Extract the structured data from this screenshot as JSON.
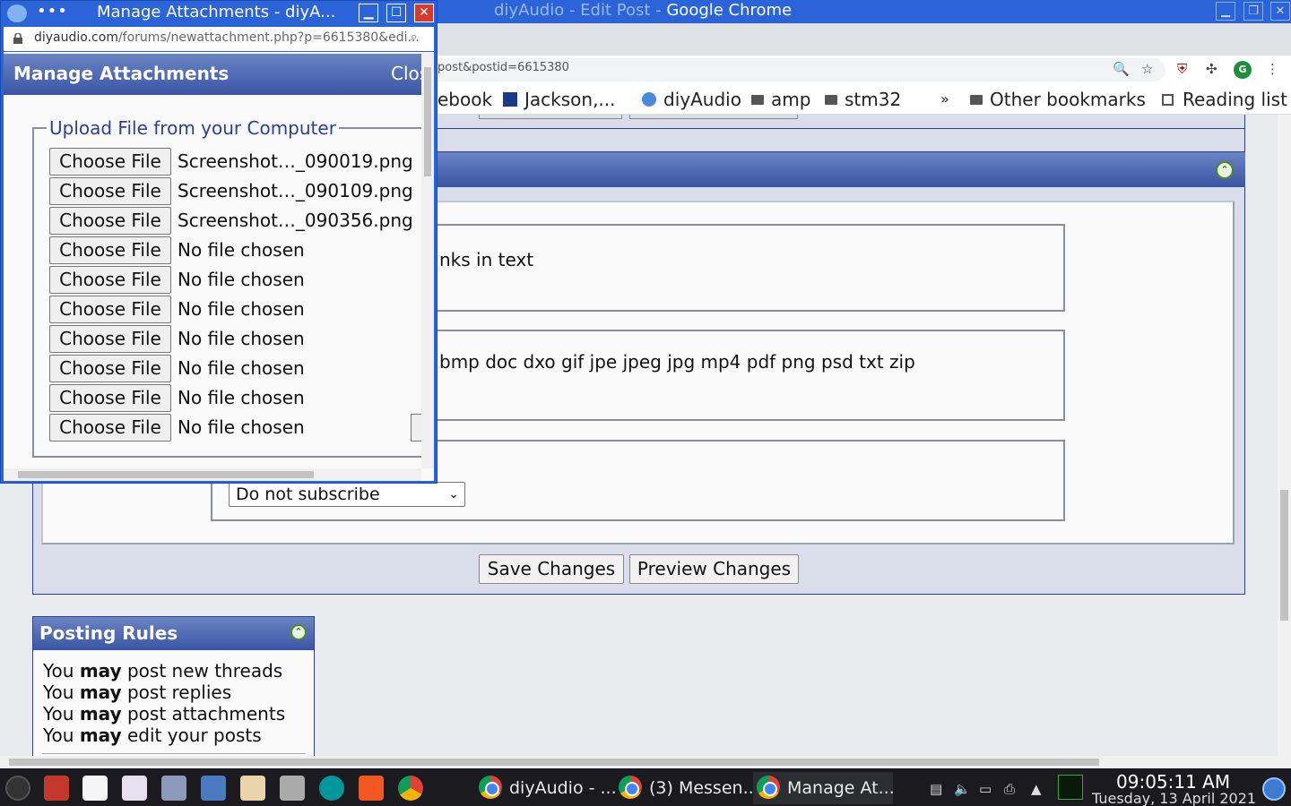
{
  "chrome": {
    "title_prefix": "diyAudio - Edit Post - ",
    "title_app": "Google Chrome",
    "url": "post&postid=6615380",
    "profile_letter": "G",
    "bookmarks": [
      "ebook",
      "Jackson,...",
      "diyAudio",
      "amp",
      "stm32",
      "»",
      "Other bookmarks",
      "Reading list"
    ]
  },
  "page": {
    "field1_text": "nks in text",
    "field2_text": "bmp doc dxo gif jpe jpeg jpg mp4 pdf png psd txt zip",
    "subscribe_value": "Do not subscribe",
    "save_label": "Save Changes",
    "preview_label": "Preview Changes",
    "rules": {
      "title": "Posting Rules",
      "lines": [
        {
          "pre": "You ",
          "bold": "may",
          "post": " post new threads"
        },
        {
          "pre": "You ",
          "bold": "may",
          "post": " post replies"
        },
        {
          "pre": "You ",
          "bold": "may",
          "post": " post attachments"
        },
        {
          "pre": "You ",
          "bold": "may",
          "post": " edit your posts"
        }
      ]
    }
  },
  "popup": {
    "window_title": "Manage Attachments - diyA...",
    "url_host": "diyaudio.com",
    "url_rest": "/forums/newattachment.php?p=6615380&edi...",
    "header_title": "Manage Attachments",
    "header_close": "Close",
    "legend": "Upload File from your Computer",
    "files": [
      {
        "button": "Choose File",
        "name": "Screenshot…_090019.png"
      },
      {
        "button": "Choose File",
        "name": "Screenshot…_090109.png"
      },
      {
        "button": "Choose File",
        "name": "Screenshot…_090356.png"
      },
      {
        "button": "Choose File",
        "name": "No file chosen"
      },
      {
        "button": "Choose File",
        "name": "No file chosen"
      },
      {
        "button": "Choose File",
        "name": "No file chosen"
      },
      {
        "button": "Choose File",
        "name": "No file chosen"
      },
      {
        "button": "Choose File",
        "name": "No file chosen"
      },
      {
        "button": "Choose File",
        "name": "No file chosen"
      },
      {
        "button": "Choose File",
        "name": "No file chosen"
      }
    ]
  },
  "taskbar": {
    "tasks": [
      "diyAudio - ...",
      "(3) Messen...",
      "Manage At..."
    ],
    "time": "09:05:11 AM",
    "date": "Tuesday, 13 April 2021"
  },
  "colors": {
    "titlebar": "#2a64d8",
    "header_gradient_top": "#6b84c3",
    "header_gradient_bottom": "#3a55a5",
    "legend": "#2b3f98"
  }
}
